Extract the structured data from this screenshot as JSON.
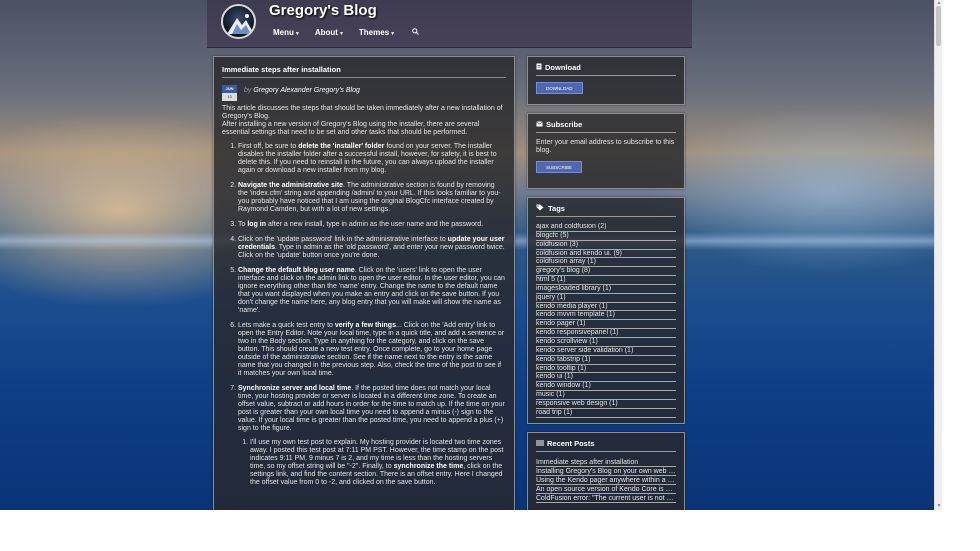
{
  "header": {
    "title": "Gregory's Blog",
    "nav": [
      {
        "label": "Menu"
      },
      {
        "label": "About"
      },
      {
        "label": "Themes"
      }
    ]
  },
  "article": {
    "title": "Immediate steps after installation",
    "date_month": "JUN",
    "date_day": "13",
    "by": "by",
    "author": "Gregory Alexander Gregory's Blog",
    "intro_1": "This article discusses the steps that should be taken immediately after a new installation of Gregory's Blog.",
    "intro_2": "After installing a new version of Gregory's Blog using the installer, there are several essential settings that need to be set and other tasks that should be performed.",
    "steps": [
      {
        "pre": "First off, be sure to ",
        "bold": "delete the 'installer' folder",
        "post": " found on your server. The installer disables the installer folder after a successful install, however, for safety, it is best to delete this. If you need to reinstall in the future, you can always upload the installer again or download a new installer from my blog."
      },
      {
        "pre": "",
        "bold": "Navigate the administrative site",
        "post": ". The administrative section is found by removing the 'index.cfm' string and appending /admin/ to your URL. If this looks familiar to you- you probably have noticed that I am using the original BlogCfc interface created by Raymond Camden, but with a lot of new settings."
      },
      {
        "pre": "To ",
        "bold": "log in",
        "post": " after a new install, type in admin as the user name and the password."
      },
      {
        "pre": "Click on the 'update password' link in the administrative interface to ",
        "bold": "update your user credentials",
        "post": ". Type in admin as the 'old password', and enter your new password twice. Click on the 'update' button once you're done."
      },
      {
        "pre": "",
        "bold": "Change the default blog user name",
        "post": ". Click on the 'users' link to open the user interface and click on the admin link to open the user editor. In the user editor, you can ignore everything other than the 'name' entry. Change the name to the default name that you want displayed when you make an entry and click on the save button. If you don't change the name here, any blog entry that you will make will show the name as 'name'."
      },
      {
        "pre": "Lets make a quick test entry to ",
        "bold": "verify a few things",
        "post": "... Click on the 'Add entry' link to open the Entry Editor. Note your local time, type in a quick title, and add a sentence or two in the Body section. Type in anything for the category, and click on the save button. This should create a new test entry. Once complete, go to your home page outside of the administrative section. See if the name next to the entry is the same name that you changed in the previous step. Also, check the time of the post to see if it matches your own local time."
      },
      {
        "pre": "",
        "bold": "Synchronize server and local time",
        "post": ". If the posted time does not match your local time, your hosting provider or server is located in a different time zone. To create an offset value, subtract or add hours in order for the time to match up. If the time on your post is greater than your own local time you need to append a minus (-) sign to the value. If your local time is greater than the posted time, you need to append a plus (+) sign to the figure."
      }
    ],
    "substep": {
      "pre": "I'll use my own test post to explain. My hosting provider is located two time zones away. I posted this test post at 7:11 PM PST. However, the time stamp on the post indicates 9:11 PM. 9 minus 7 is 2, and my time is less than the hosting servers time, so my offset string will be \"-2\". Finally, to ",
      "bold": "synchronize the time",
      "post": ", click on the settings link, and find the content section. There is an offset entry. Here I changed the offset value from 0 to -2, and clicked on the save button."
    }
  },
  "sidebar": {
    "download": {
      "title": "Download",
      "button": "DOWNLOAD"
    },
    "subscribe": {
      "title": "Subscribe",
      "text": "Enter your email address to subscribe to this blog.",
      "button": "SUBSCRIBE"
    },
    "tags": {
      "title": "Tags",
      "items": [
        "ajax and coldfusion (2)",
        "blogcfc (5)",
        "coldfusion (3)",
        "coldfusion and kendo ui. (9)",
        "coldfusion array (1)",
        "gregory's blog (8)",
        "html 5 (1)",
        "imagesloaded library (1)",
        "jquery (1)",
        "kendo media player (1)",
        "kendo mvvm template (1)",
        "kendo pager (1)",
        "kendo responsivepanel (1)",
        "kendo scrollview (1)",
        "kendo server side validation (1)",
        "kendo tabstrip (1)",
        "kendo tooltip (1)",
        "kendo ui (1)",
        "kendo window (1)",
        "music (1)",
        "responsive web design (1)",
        "road trip (1)"
      ]
    },
    "recent": {
      "title": "Recent Posts",
      "items": [
        "Immediate steps after installation",
        "Installing Gregory's Blog on your own web server",
        "Using the Kendo pager anywhere within a page",
        "An open source version of Kendo Core is now available",
        "ColdFusion error: \"The current user is not authorized\""
      ]
    }
  },
  "colors": {
    "button": "#4f66b0",
    "panel": "#28282c",
    "header": "#3e3a50"
  },
  "icons": [
    "logo-icon",
    "caret-down-icon",
    "search-icon",
    "file-icon",
    "envelope-icon",
    "tags-icon",
    "list-icon"
  ]
}
